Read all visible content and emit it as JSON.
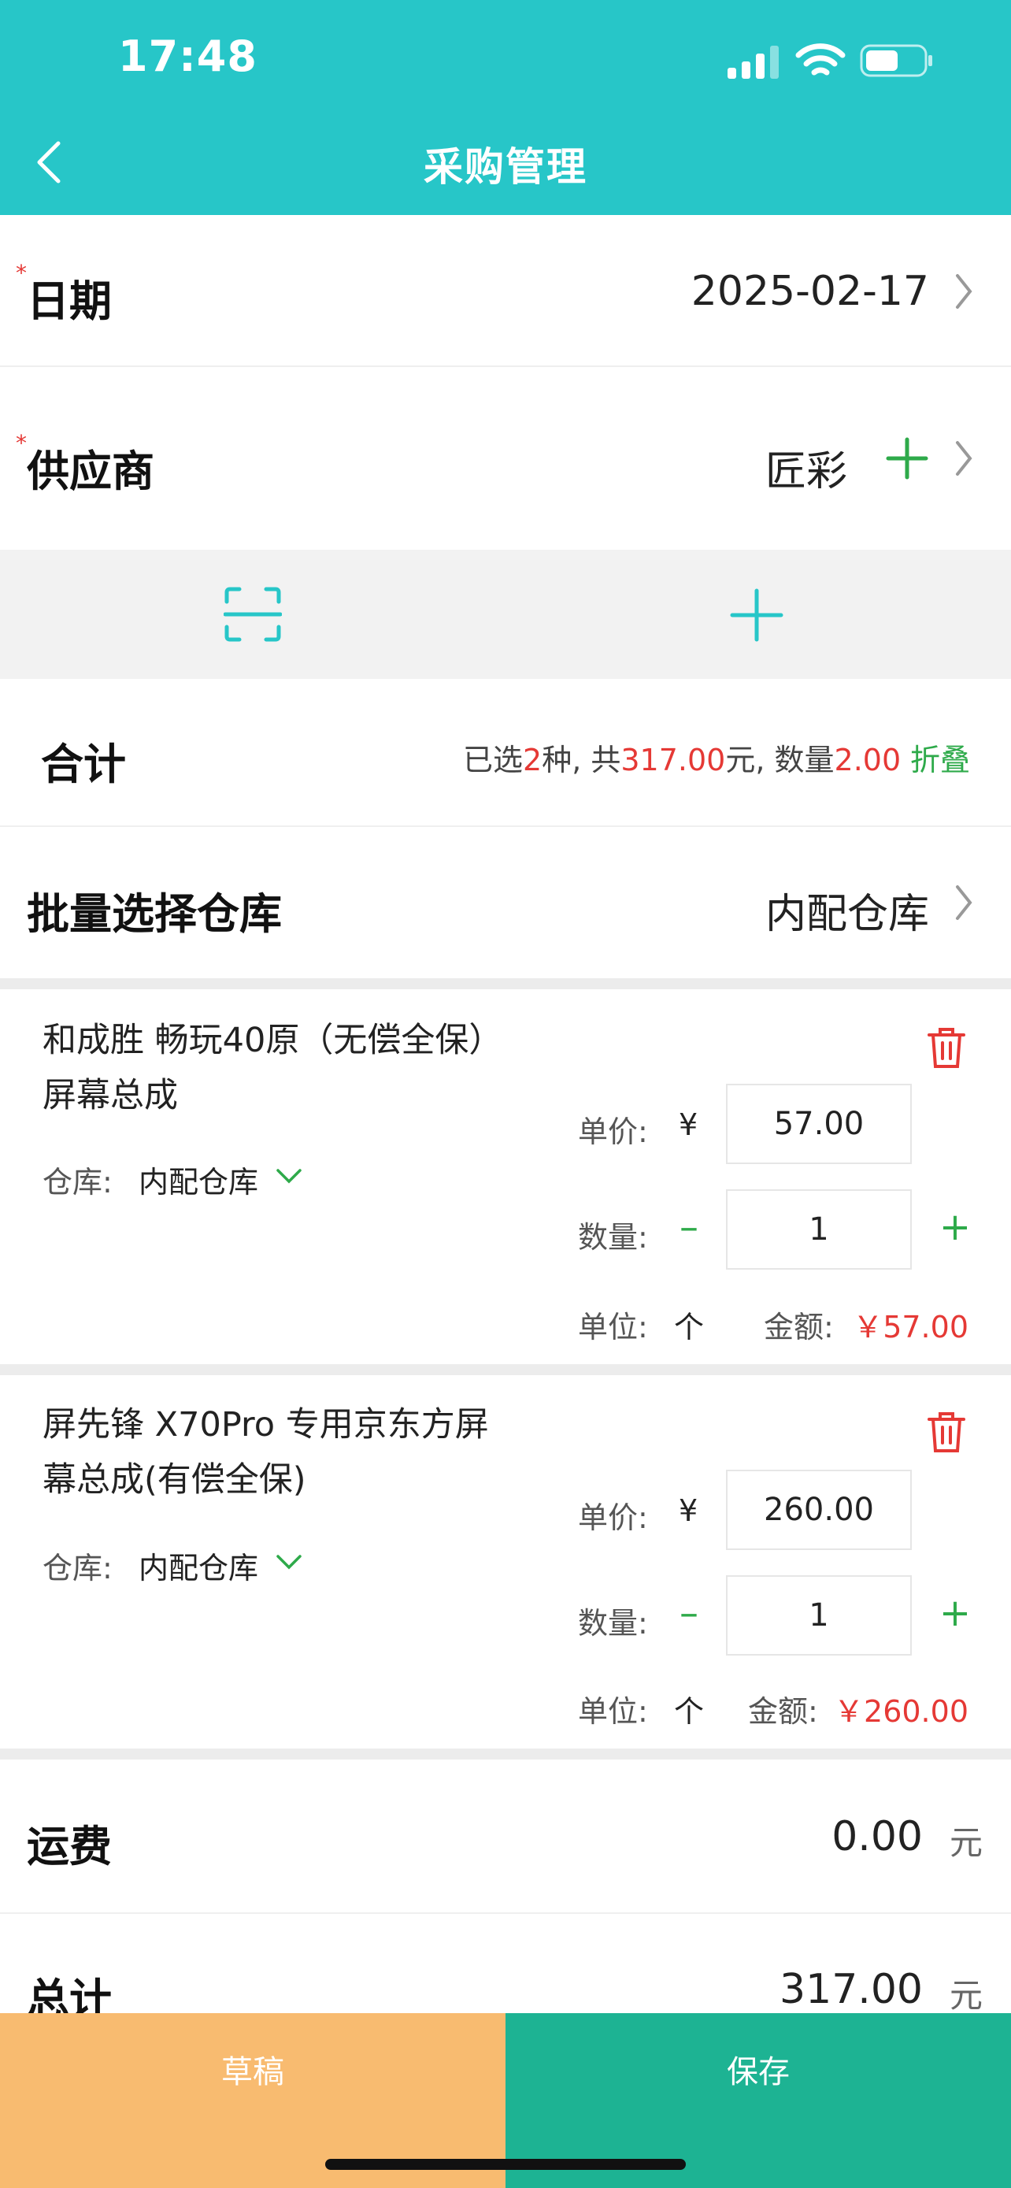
{
  "status_bar": {
    "time": "17:48"
  },
  "nav": {
    "title": "采购管理"
  },
  "form": {
    "date_label": "日期",
    "date_value": "2025-02-17",
    "supplier_label": "供应商",
    "supplier_value": "匠彩",
    "required_mark": "*"
  },
  "summary": {
    "label": "合计",
    "prefix": "已选",
    "kinds": "2",
    "kinds_suffix": "种, 共",
    "total": "317.00",
    "total_suffix": "元, 数量",
    "qty": "2.00",
    "fold": "折叠"
  },
  "warehouse_batch": {
    "label": "批量选择仓库",
    "value": "内配仓库"
  },
  "items": [
    {
      "name": "和成胜 畅玩40原（无偿全保）屏幕总成",
      "warehouse_label": "仓库:",
      "warehouse": "内配仓库",
      "price_label": "单价:",
      "currency": "¥",
      "price": "57.00",
      "qty_label": "数量:",
      "qty": "1",
      "unit_label": "单位:",
      "unit": "个",
      "amount_label": "金额:",
      "amount": "￥57.00"
    },
    {
      "name": "屏先锋 X70Pro 专用京东方屏幕总成(有偿全保)",
      "warehouse_label": "仓库:",
      "warehouse": "内配仓库",
      "price_label": "单价:",
      "currency": "¥",
      "price": "260.00",
      "qty_label": "数量:",
      "qty": "1",
      "unit_label": "单位:",
      "unit": "个",
      "amount_label": "金额:",
      "amount": "￥260.00"
    }
  ],
  "freight": {
    "label": "运费",
    "value": "0.00",
    "unit": "元"
  },
  "grand_total": {
    "label": "总计",
    "value": "317.00",
    "unit": "元"
  },
  "buttons": {
    "draft": "草稿",
    "save": "保存"
  },
  "colors": {
    "primary": "#27c6c8",
    "draft": "#f8bb70",
    "save": "#1db393",
    "accent_red": "#e53935",
    "accent_green": "#2eaa4a"
  }
}
